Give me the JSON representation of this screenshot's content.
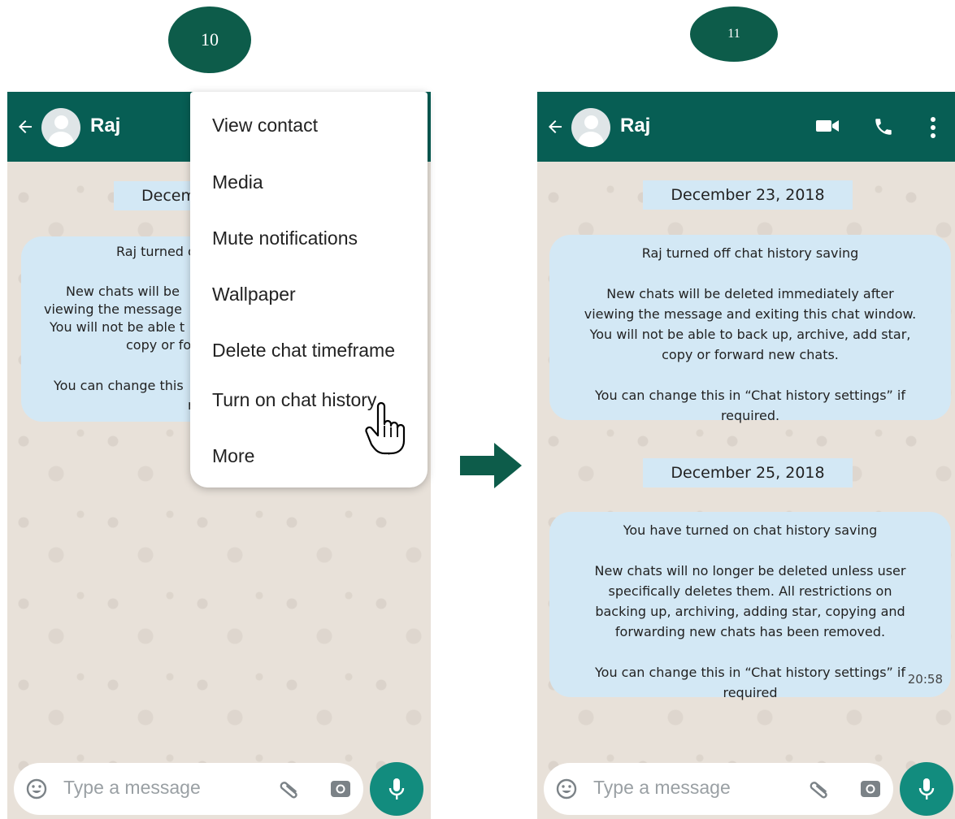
{
  "steps": {
    "left": "10",
    "right": "11"
  },
  "contact": {
    "name": "Raj"
  },
  "left_screen": {
    "date_chip_visible": "Decem",
    "bubble_lines": [
      "Raj turned o",
      "New chats will be",
      "viewing the message",
      "You will not be able t",
      "copy or fo",
      "You can change this",
      "r"
    ],
    "menu": {
      "items": [
        "View contact",
        "Media",
        "Mute notifications",
        "Wallpaper",
        "Delete chat timeframe",
        "Turn on chat history",
        "More"
      ]
    }
  },
  "right_screen": {
    "date1": "December 23, 2018",
    "notice1": {
      "title": "Raj turned off chat history saving",
      "lines": [
        "New chats will be deleted immediately after",
        "viewing the message and exiting this chat window.",
        "You will not be able to back up, archive, add star,",
        "copy or forward new chats."
      ],
      "footer": [
        "You can change this  in “Chat history settings” if",
        "required."
      ]
    },
    "date2": "December 25, 2018",
    "notice2": {
      "title": "You have turned on chat history saving",
      "lines": [
        "New chats will no longer be deleted unless user",
        "specifically deletes them. All restrictions on",
        "backing up, archiving, adding star, copying and",
        "forwarding new chats has been removed."
      ],
      "footer": [
        "You can change this  in “Chat history settings” if",
        "required"
      ],
      "time": "20:58"
    }
  },
  "input": {
    "placeholder": "Type a message"
  },
  "colors": {
    "header": "#075e54",
    "badge": "#0d5c4a",
    "mic": "#128c7e",
    "system_bubble": "#d3e8f5",
    "wallpaper": "#e8e1d9"
  },
  "icons": [
    "back-arrow-icon",
    "avatar-icon",
    "video-call-icon",
    "phone-call-icon",
    "more-vert-icon",
    "emoji-icon",
    "attach-icon",
    "camera-icon",
    "mic-icon",
    "hand-cursor-icon",
    "flow-arrow-icon"
  ]
}
